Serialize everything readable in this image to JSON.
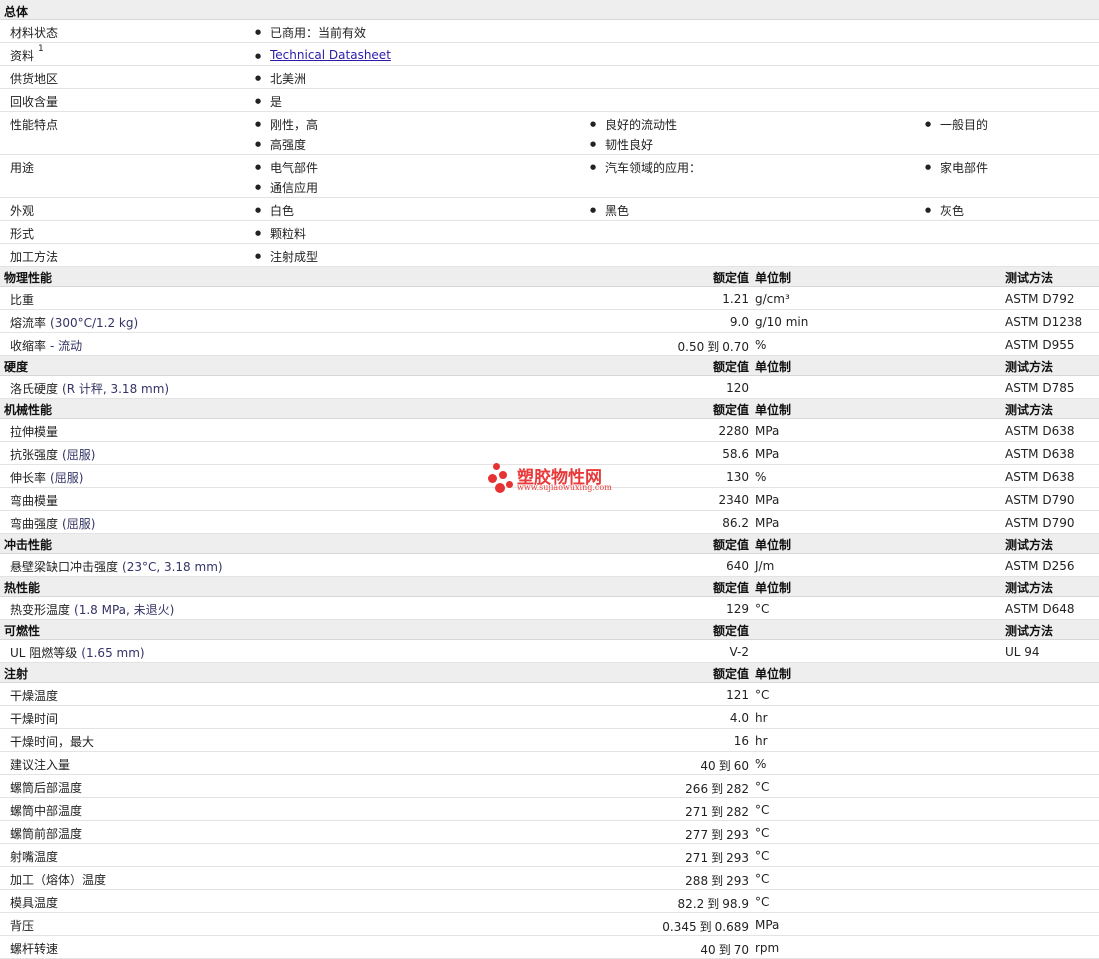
{
  "general": {
    "title": "总体",
    "rows": [
      {
        "label": "材料状态",
        "items": [
          "已商用：当前有效"
        ]
      },
      {
        "label": "资料",
        "sup": "1",
        "link": "Technical Datasheet"
      },
      {
        "label": "供货地区",
        "items": [
          "北美洲"
        ]
      },
      {
        "label": "回收含量",
        "items": [
          "是"
        ]
      },
      {
        "label": "性能特点",
        "items": [
          "刚性，高",
          "良好的流动性",
          "一般目的",
          "高强度",
          "韧性良好"
        ]
      },
      {
        "label": "用途",
        "items": [
          "电气部件",
          "汽车领域的应用：",
          "家电部件",
          "通信应用"
        ]
      },
      {
        "label": "外观",
        "items": [
          "白色",
          "黑色",
          "灰色"
        ]
      },
      {
        "label": "形式",
        "items": [
          "颗粒料"
        ]
      },
      {
        "label": "加工方法",
        "items": [
          "注射成型"
        ]
      }
    ]
  },
  "columns": {
    "nominal": "额定值",
    "unit": "单位制",
    "method": "测试方法"
  },
  "sections": [
    {
      "title": "物理性能",
      "show_unit": true,
      "show_method": true,
      "rows": [
        {
          "label": "比重",
          "value": "1.21",
          "unit": "g/cm³",
          "method": "ASTM D792"
        },
        {
          "label": "熔流率",
          "cond": "(300°C/1.2 kg)",
          "value": "9.0",
          "unit": "g/10 min",
          "method": "ASTM D1238"
        },
        {
          "label": "收缩率",
          "cond": "- 流动",
          "value": "0.50",
          "value2": "0.70",
          "unit": "%",
          "method": "ASTM D955"
        }
      ]
    },
    {
      "title": "硬度",
      "show_unit": true,
      "show_method": true,
      "rows": [
        {
          "label": "洛氏硬度",
          "cond": "(R 计秤, 3.18 mm)",
          "value": "120",
          "unit": "",
          "method": "ASTM D785"
        }
      ]
    },
    {
      "title": "机械性能",
      "show_unit": true,
      "show_method": true,
      "rows": [
        {
          "label": "拉伸模量",
          "value": "2280",
          "unit": "MPa",
          "method": "ASTM D638"
        },
        {
          "label": "抗张强度",
          "cond": "(屈服)",
          "value": "58.6",
          "unit": "MPa",
          "method": "ASTM D638"
        },
        {
          "label": "伸长率",
          "cond": "(屈服)",
          "value": "130",
          "unit": "%",
          "method": "ASTM D638"
        },
        {
          "label": "弯曲模量",
          "value": "2340",
          "unit": "MPa",
          "method": "ASTM D790"
        },
        {
          "label": "弯曲强度",
          "cond": "(屈服)",
          "value": "86.2",
          "unit": "MPa",
          "method": "ASTM D790"
        }
      ]
    },
    {
      "title": "冲击性能",
      "show_unit": true,
      "show_method": true,
      "rows": [
        {
          "label": "悬壁梁缺口冲击强度",
          "cond": "(23°C, 3.18 mm)",
          "value": "640",
          "unit": "J/m",
          "method": "ASTM D256"
        }
      ]
    },
    {
      "title": "热性能",
      "show_unit": true,
      "show_method": true,
      "rows": [
        {
          "label": "热变形温度",
          "cond": "(1.8 MPa, 未退火)",
          "value": "129",
          "unit": "°C",
          "method": "ASTM D648"
        }
      ]
    },
    {
      "title": "可燃性",
      "show_unit": false,
      "show_method": true,
      "rows": [
        {
          "label": "UL 阻燃等级",
          "cond": "(1.65 mm)",
          "value": "V-2",
          "unit": "",
          "method": "UL 94"
        }
      ]
    },
    {
      "title": "注射",
      "show_unit": true,
      "show_method": false,
      "rows": [
        {
          "label": "干燥温度",
          "value": "121",
          "unit": "°C"
        },
        {
          "label": "干燥时间",
          "value": "4.0",
          "unit": "hr"
        },
        {
          "label": "干燥时间，最大",
          "value": "16",
          "unit": "hr"
        },
        {
          "label": "建议注入量",
          "value": "40",
          "value2": "60",
          "unit": "%"
        },
        {
          "label": "螺筒后部温度",
          "value": "266",
          "value2": "282",
          "unit": "°C"
        },
        {
          "label": "螺筒中部温度",
          "value": "271",
          "value2": "282",
          "unit": "°C"
        },
        {
          "label": "螺筒前部温度",
          "value": "277",
          "value2": "293",
          "unit": "°C"
        },
        {
          "label": "射嘴温度",
          "value": "271",
          "value2": "293",
          "unit": "°C"
        },
        {
          "label": "加工（熔体）温度",
          "value": "288",
          "value2": "293",
          "unit": "°C"
        },
        {
          "label": "模具温度",
          "value": "82.2",
          "value2": "98.9",
          "unit": "°C"
        },
        {
          "label": "背压",
          "value": "0.345",
          "value2": "0.689",
          "unit": "MPa"
        },
        {
          "label": "螺杆转速",
          "value": "40",
          "value2": "70",
          "unit": "rpm"
        }
      ]
    }
  ],
  "range_word": "到",
  "watermark": {
    "title": "塑胶物性网",
    "url": "www.sujiaowuxing.com"
  }
}
